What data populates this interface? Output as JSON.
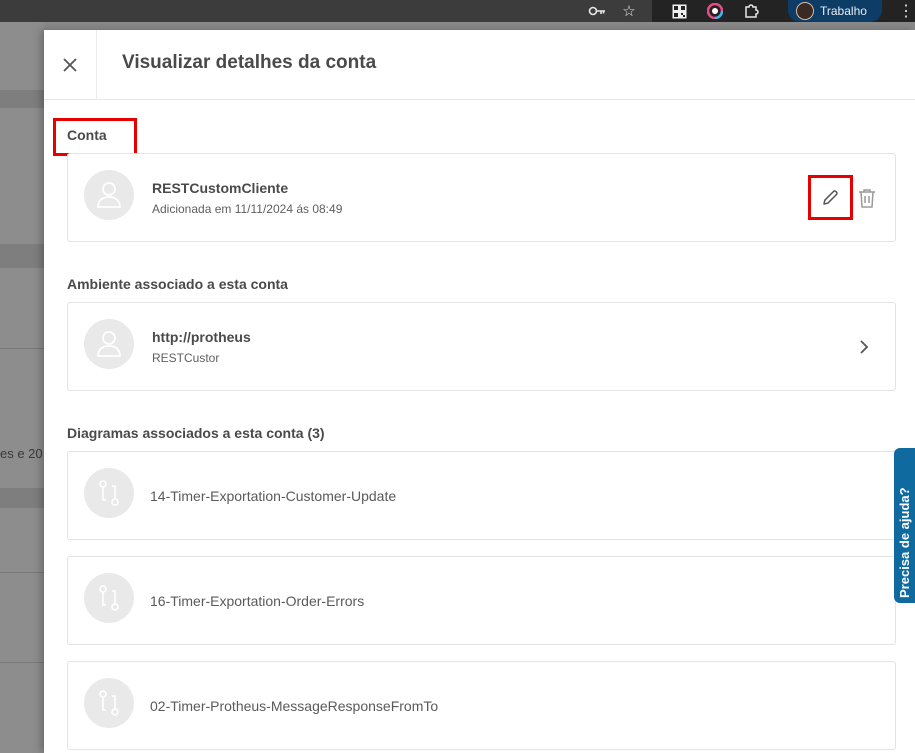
{
  "browser": {
    "profile_label": "Trabalho",
    "icons": [
      "key-icon",
      "star-icon",
      "qr-icon",
      "color-icon",
      "extensions-icon",
      "menu-kebab-icon"
    ]
  },
  "background": {
    "partial_text": "es e 20"
  },
  "drawer": {
    "title": "Visualizar detalhes da conta",
    "account_section": {
      "label": "Conta",
      "name": "RESTCustomCliente",
      "added": "Adicionada em 11/11/2024 ás 08:49"
    },
    "environment_section": {
      "label": "Ambiente associado a esta conta",
      "url": "http://protheus",
      "account_ref": "RESTCustor"
    },
    "diagrams_section": {
      "label": "Diagramas associados a esta conta (3)",
      "items": [
        {
          "name": "14-Timer-Exportation-Customer-Update"
        },
        {
          "name": "16-Timer-Exportation-Order-Errors"
        },
        {
          "name": "02-Timer-Protheus-MessageResponseFromTo"
        }
      ]
    }
  },
  "help_tab": {
    "label": "Precisa de ajuda?"
  },
  "colors": {
    "highlight": "#e60000",
    "help_tab": "#0f6aa0",
    "profile_pill": "#0d3d66"
  }
}
